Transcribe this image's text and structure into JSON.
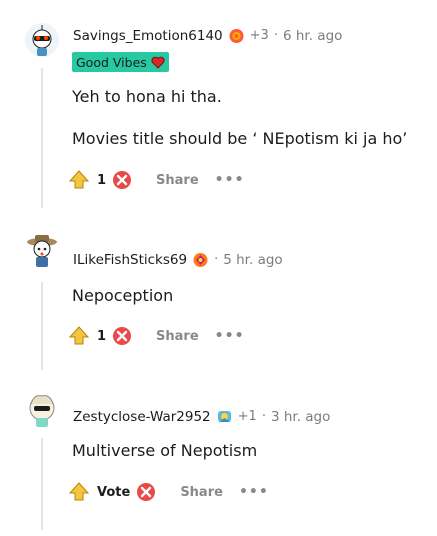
{
  "comments": [
    {
      "username": "Savings_Emotion6140",
      "award_count": "+3",
      "separator": "·",
      "time": "6 hr. ago",
      "flair": "Good Vibes",
      "paragraphs": [
        "Yeh to hona hi tha.",
        "Movies title should be ‘ NEpotism ki ja ho’"
      ],
      "votes": "1",
      "share_label": "Share",
      "more_label": "•••"
    },
    {
      "username": "ILikeFishSticks69",
      "award_count": "",
      "separator": "·",
      "time": "5 hr. ago",
      "paragraphs": [
        "Nepoception"
      ],
      "votes": "1",
      "share_label": "Share",
      "more_label": "•••"
    },
    {
      "username": "Zestyclose-War2952",
      "award_count": "+1",
      "separator": "·",
      "time": "3 hr. ago",
      "paragraphs": [
        "Multiverse of Nepotism"
      ],
      "votes": "Vote",
      "share_label": "Share",
      "more_label": "•••"
    }
  ],
  "colors": {
    "flair_bg": "#26c9a1",
    "upvote_fill": "#f5c542",
    "downvote_fill": "#e84a4a"
  }
}
